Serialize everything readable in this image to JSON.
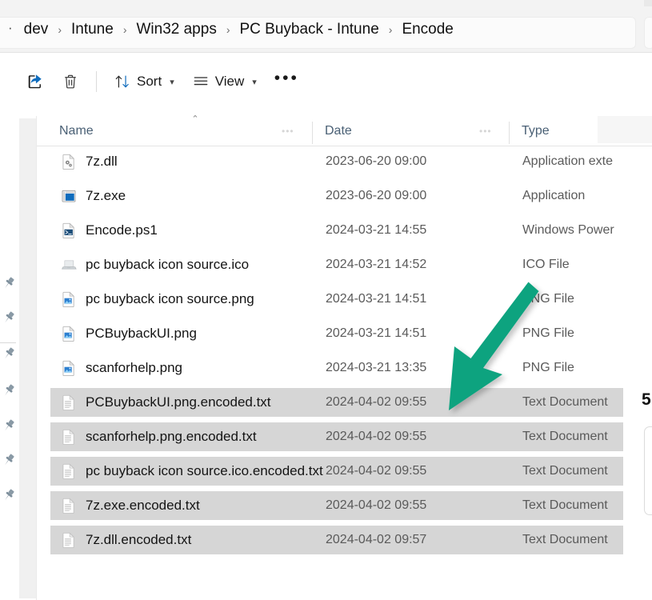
{
  "window": {
    "breadcrumb_lead": "·",
    "breadcrumb": [
      {
        "label": "dev"
      },
      {
        "label": "Intune"
      },
      {
        "label": "Win32 apps"
      },
      {
        "label": "PC Buyback - Intune"
      },
      {
        "label": "Encode"
      }
    ],
    "breadcrumb_separator": "›"
  },
  "toolbar": {
    "share_icon": "share-icon",
    "delete_icon": "trash-icon",
    "sort_icon": "sort-arrows-icon",
    "sort_label": "Sort",
    "view_icon": "list-lines-icon",
    "view_label": "View",
    "more_label": "•••",
    "chevron": "⌄"
  },
  "columns": {
    "name": "Name",
    "date": "Date",
    "type": "Type",
    "sort_indicator": "⌃"
  },
  "files": [
    {
      "name": "7z.dll",
      "date": "2023-06-20 09:00",
      "type": "Application exte",
      "icon": "dll-file-icon",
      "selected": false
    },
    {
      "name": "7z.exe",
      "date": "2023-06-20 09:00",
      "type": "Application",
      "icon": "exe-app-icon",
      "selected": false
    },
    {
      "name": "Encode.ps1",
      "date": "2024-03-21 14:55",
      "type": "Windows Power",
      "icon": "powershell-file-icon",
      "selected": false
    },
    {
      "name": "pc buyback icon source.ico",
      "date": "2024-03-21 14:52",
      "type": "ICO File",
      "icon": "laptop-ico-icon",
      "selected": false
    },
    {
      "name": "pc buyback icon source.png",
      "date": "2024-03-21 14:51",
      "type": "PNG File",
      "icon": "image-file-icon",
      "selected": false
    },
    {
      "name": "PCBuybackUI.png",
      "date": "2024-03-21 14:51",
      "type": "PNG File",
      "icon": "image-file-icon",
      "selected": false
    },
    {
      "name": "scanforhelp.png",
      "date": "2024-03-21 13:35",
      "type": "PNG File",
      "icon": "image-file-icon",
      "selected": false
    },
    {
      "name": "PCBuybackUI.png.encoded.txt",
      "date": "2024-04-02 09:55",
      "type": "Text Document",
      "icon": "text-file-icon",
      "selected": true
    },
    {
      "name": "scanforhelp.png.encoded.txt",
      "date": "2024-04-02 09:55",
      "type": "Text Document",
      "icon": "text-file-icon",
      "selected": true
    },
    {
      "name": "pc buyback icon source.ico.encoded.txt",
      "date": "2024-04-02 09:55",
      "type": "Text Document",
      "icon": "text-file-icon",
      "selected": true
    },
    {
      "name": "7z.exe.encoded.txt",
      "date": "2024-04-02 09:55",
      "type": "Text Document",
      "icon": "text-file-icon",
      "selected": true
    },
    {
      "name": "7z.dll.encoded.txt",
      "date": "2024-04-02 09:57",
      "type": "Text Document",
      "icon": "text-file-icon",
      "selected": true
    }
  ],
  "sidebar": {
    "pins": [
      {
        "icon": "pin-icon"
      },
      {
        "icon": "pin-icon"
      },
      {
        "icon": "pin-icon"
      },
      {
        "icon": "pin-icon"
      },
      {
        "icon": "pin-icon"
      },
      {
        "icon": "pin-icon"
      },
      {
        "icon": "pin-icon"
      }
    ]
  },
  "right": {
    "count": "5"
  },
  "annotation": {
    "arrow_color": "#10A37F",
    "arrow_from": "665,357",
    "arrow_to": "565,512"
  },
  "colors": {
    "selection": "#D6D6D6",
    "accent_blue": "#0F6CBD",
    "header_text": "#4A6075",
    "chrome": "#F3F3F3"
  }
}
